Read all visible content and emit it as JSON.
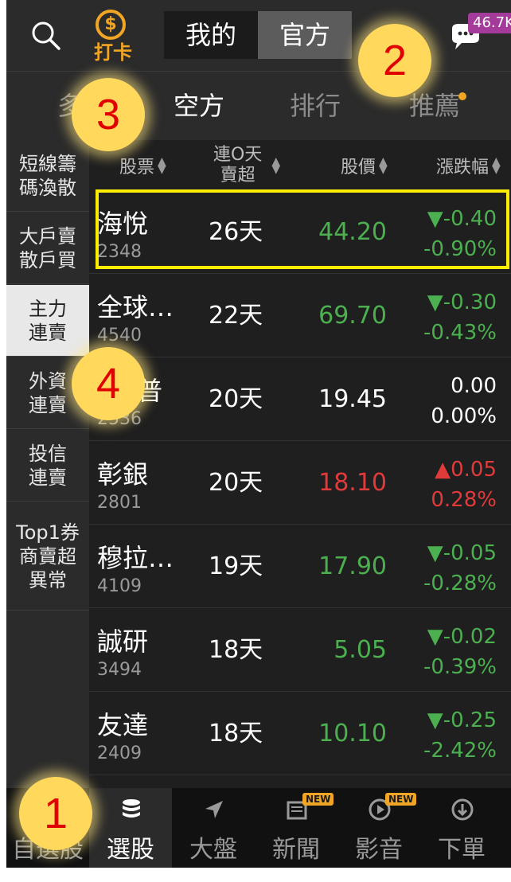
{
  "topbar": {
    "checkin_label": "打卡",
    "checkin_coin": "$",
    "segments": [
      {
        "label": "我的",
        "active": false
      },
      {
        "label": "官方",
        "active": true
      }
    ],
    "chat_badge": "46.7K"
  },
  "subtabs": [
    {
      "label": "多",
      "active": false
    },
    {
      "label": "空方",
      "active": true
    },
    {
      "label": "排行",
      "active": false
    },
    {
      "label": "推薦",
      "active": false,
      "dot": true
    }
  ],
  "sidebar": [
    {
      "label": "短線籌\n碼渙散",
      "active": false
    },
    {
      "label": "大戶賣\n散戶買",
      "active": false
    },
    {
      "label": "主力\n連賣",
      "active": true
    },
    {
      "label": "外資\n連賣",
      "active": false
    },
    {
      "label": "投信\n連賣",
      "active": false
    },
    {
      "label": "Top1券\n商賣超\n異常",
      "active": false
    }
  ],
  "table": {
    "headers": {
      "stock": "股票",
      "days_line1": "連O天",
      "days_line2": "賣超",
      "price": "股價",
      "change": "漲跌幅"
    },
    "rows": [
      {
        "name": "海悅",
        "code": "2348",
        "days": "26天",
        "price": "44.20",
        "change": "▼-0.40",
        "pct": "-0.90%",
        "dir": "down"
      },
      {
        "name": "全球…",
        "code": "4540",
        "days": "22天",
        "price": "69.70",
        "change": "▼-0.30",
        "pct": "-0.43%",
        "dir": "down"
      },
      {
        "name": "普",
        "code": "2536",
        "days": "20天",
        "price": "19.45",
        "change": "0.00",
        "pct": "0.00%",
        "dir": "flat"
      },
      {
        "name": "彰銀",
        "code": "2801",
        "days": "20天",
        "price": "18.10",
        "change": "▲0.05",
        "pct": "0.28%",
        "dir": "up"
      },
      {
        "name": "穆拉…",
        "code": "4109",
        "days": "19天",
        "price": "17.90",
        "change": "▼-0.05",
        "pct": "-0.28%",
        "dir": "down"
      },
      {
        "name": "誠研",
        "code": "3494",
        "days": "18天",
        "price": "5.05",
        "change": "▼-0.02",
        "pct": "-0.39%",
        "dir": "down"
      },
      {
        "name": "友達",
        "code": "2409",
        "days": "18天",
        "price": "10.10",
        "change": "▼-0.25",
        "pct": "-2.42%",
        "dir": "down"
      }
    ]
  },
  "bottomnav": [
    {
      "label": "自選股",
      "icon": "star-icon",
      "active": false
    },
    {
      "label": "選股",
      "icon": "database-icon",
      "active": true
    },
    {
      "label": "大盤",
      "icon": "arrow-icon",
      "active": false
    },
    {
      "label": "新聞",
      "icon": "newspaper-icon",
      "active": false,
      "badge": "NEW"
    },
    {
      "label": "影音",
      "icon": "play-icon",
      "active": false,
      "badge": "NEW"
    },
    {
      "label": "下單",
      "icon": "download-icon",
      "active": false
    }
  ],
  "callouts": [
    "1",
    "2",
    "3",
    "4"
  ],
  "colors": {
    "up": "#e03a3a",
    "down": "#4caf50",
    "highlight": "#ffec00",
    "accent": "#f0a524"
  }
}
